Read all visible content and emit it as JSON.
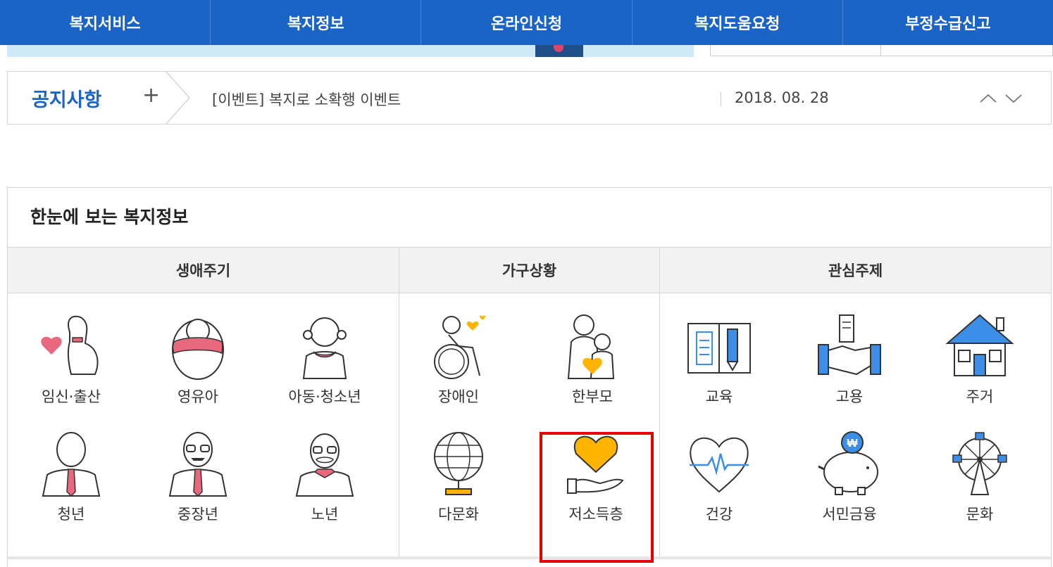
{
  "topnav": {
    "items": [
      "복지서비스",
      "복지정보",
      "온라인신청",
      "복지도움요청",
      "부정수급신고"
    ]
  },
  "notice": {
    "title": "공지사항",
    "plus": "+",
    "text": "[이벤트] 복지로 소확행 이벤트",
    "date": "2018. 08. 28"
  },
  "panel": {
    "title": "한눈에 보는 복지정보",
    "categories": [
      "생애주기",
      "가구상황",
      "관심주제"
    ],
    "tiles": [
      {
        "label": "임신·출산",
        "icon": "pregnant-icon"
      },
      {
        "label": "영유아",
        "icon": "infant-icon"
      },
      {
        "label": "아동·청소년",
        "icon": "child-icon"
      },
      {
        "label": "장애인",
        "icon": "wheelchair-icon"
      },
      {
        "label": "한부모",
        "icon": "single-parent-icon"
      },
      {
        "label": "교육",
        "icon": "book-icon"
      },
      {
        "label": "고용",
        "icon": "handshake-icon"
      },
      {
        "label": "주거",
        "icon": "house-icon"
      },
      {
        "label": "청년",
        "icon": "young-man-icon"
      },
      {
        "label": "중장년",
        "icon": "middle-aged-icon"
      },
      {
        "label": "노년",
        "icon": "elderly-icon"
      },
      {
        "label": "다문화",
        "icon": "globe-icon"
      },
      {
        "label": "저소득층",
        "icon": "heart-hand-icon"
      },
      {
        "label": "건강",
        "icon": "heartbeat-icon"
      },
      {
        "label": "서민금융",
        "icon": "piggy-bank-icon"
      },
      {
        "label": "문화",
        "icon": "ferris-wheel-icon"
      }
    ]
  },
  "colors": {
    "nav_bg": "#1a63c7",
    "accent_blue": "#1a63c7",
    "highlight": "#e60000",
    "icon_pink": "#e8697d",
    "icon_orange": "#ffb400",
    "icon_blue": "#3d8ee6"
  }
}
